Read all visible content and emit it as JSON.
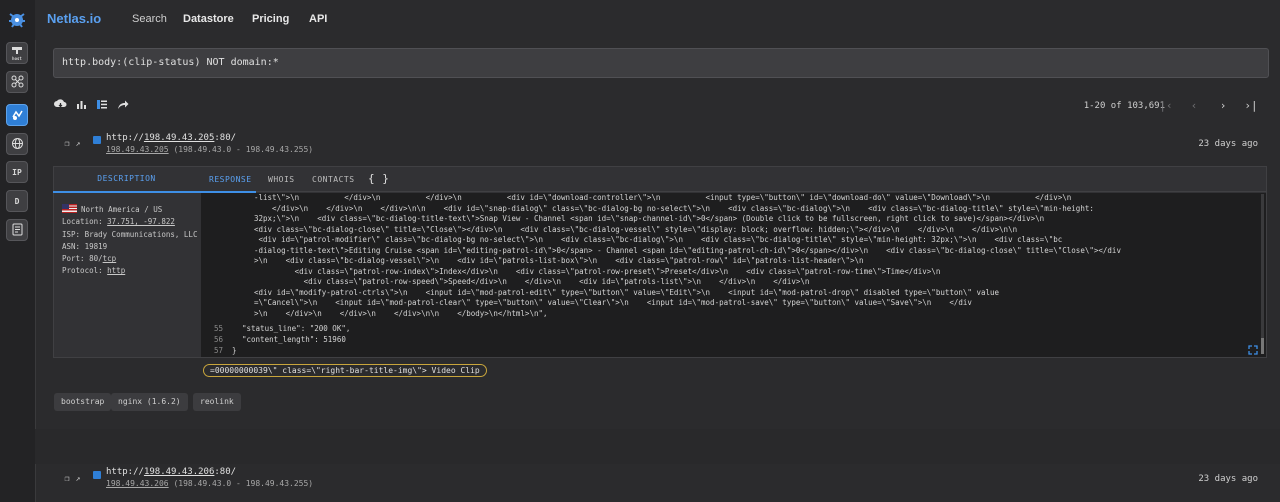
{
  "nav": {
    "brand": "Netlas.io",
    "links": [
      "Search",
      "Datastore",
      "Pricing",
      "API"
    ]
  },
  "rail": [
    {
      "icon": "host-icon",
      "label": "host",
      "active": false
    },
    {
      "icon": "network-icon",
      "label": "",
      "active": false
    },
    {
      "icon": "response-icon",
      "label": "",
      "active": true
    },
    {
      "icon": "globe-icon",
      "label": "",
      "active": false
    },
    {
      "icon": "ip-whois-icon",
      "label": "IP",
      "active": false
    },
    {
      "icon": "domain-whois-icon",
      "label": "D",
      "active": false
    },
    {
      "icon": "certificate-icon",
      "label": "",
      "active": false
    }
  ],
  "search": {
    "query": "http.body:(clip-status) NOT domain:*"
  },
  "pagination": {
    "range": "1-20 of 103,691"
  },
  "results": [
    {
      "url_prefix": "http://",
      "ip": "198.49.43.205",
      "port_suffix": ":80/",
      "range_ip": "198.49.43.205",
      "range_rest": " (198.49.43.0 - 198.49.43.255)",
      "ago": "23 days ago"
    },
    {
      "url_prefix": "http://",
      "ip": "198.49.43.206",
      "port_suffix": ":80/",
      "range_ip": "198.49.43.206",
      "range_rest": " (198.49.43.0 - 198.49.43.255)",
      "ago": "23 days ago"
    }
  ],
  "tabs": {
    "description": "DESCRIPTION",
    "response": "RESPONSE",
    "whois": "WHOIS",
    "contacts": "CONTACTS",
    "json": "{ }"
  },
  "info": {
    "region": "North America / US",
    "location_label": "Location: ",
    "location": "37.751, -97.822",
    "isp": "ISP: Brady Communications, LLC",
    "asn": "ASN: 19819",
    "port_label": "Port: 80/",
    "port_proto": "tcp",
    "protocol_label": "Protocol: ",
    "protocol": "http"
  },
  "code": {
    "lines": [
      "-list\\\">\\n          </div>\\n          </div>\\n          <div id=\\\"download-controller\\\">\\n          <input type=\\\"button\\\" id=\\\"download-do\\\" value=\\\"Download\\\">\\n          </div>\\n",
      "    </div>\\n    </div>\\n    </div>\\n\\n    <div id=\\\"snap-dialog\\\" class=\\\"bc-dialog-bg no-select\\\">\\n    <div class=\\\"bc-dialog\\\">\\n    <div class=\\\"bc-dialog-title\\\" style=\\\"min-height:",
      "32px;\\\">\\n    <div class=\\\"bc-dialog-title-text\\\">Snap View - Channel <span id=\\\"snap-channel-id\\\">0</span> (Double click to be fullscreen, right click to save)</span></div>\\n",
      "<div class=\\\"bc-dialog-close\\\" title=\\\"Close\\\"></div>\\n    <div class=\\\"bc-dialog-vessel\\\" style=\\\"display: block; overflow: hidden;\\\"></div>\\n    </div>\\n    </div>\\n\\n",
      " <div id=\\\"patrol-modifier\\\" class=\\\"bc-dialog-bg no-select\\\">\\n    <div class=\\\"bc-dialog\\\">\\n    <div class=\\\"bc-dialog-title\\\" style=\\\"min-height: 32px;\\\">\\n    <div class=\\\"bc",
      "-dialog-title-text\\\">Editing Cruise <span id=\\\"editing-patrol-id\\\">0</span> - Channel <span id=\\\"editing-patrol-ch-id\\\">0</span></div>\\n    <div class=\\\"bc-dialog-close\\\" title=\\\"Close\\\"></div",
      ">\\n    <div class=\\\"bc-dialog-vessel\\\">\\n    <div id=\\\"patrols-list-box\\\">\\n    <div class=\\\"patrol-row\\\" id=\\\"patrols-list-header\\\">\\n",
      "         <div class=\\\"patrol-row-index\\\">Index</div>\\n    <div class=\\\"patrol-row-preset\\\">Preset</div>\\n    <div class=\\\"patrol-row-time\\\">Time</div>\\n",
      "           <div class=\\\"patrol-row-speed\\\">Speed</div>\\n    </div>\\n    <div id=\\\"patrols-list\\\">\\n    </div>\\n    </div>\\n",
      "<div id=\\\"modify-patrol-ctrls\\\">\\n    <input id=\\\"mod-patrol-edit\\\" type=\\\"button\\\" value=\\\"Edit\\\">\\n    <input id=\\\"mod-patrol-drop\\\" disabled type=\\\"button\\\" value",
      "=\\\"Cancel\\\">\\n    <input id=\\\"mod-patrol-clear\\\" type=\\\"button\\\" value=\\\"Clear\\\">\\n    <input id=\\\"mod-patrol-save\\\" type=\\\"button\\\" value=\\\"Save\\\">\\n    </div",
      ">\\n    </div>\\n    </div>\\n    </div>\\n\\n    </body>\\n</html>\\n\","
    ],
    "json_lines": [
      {
        "n": "55",
        "text": "\"status_line\": \"200 OK\","
      },
      {
        "n": "56",
        "text": "\"content_length\": 51960"
      },
      {
        "n": "57",
        "text": "}"
      }
    ]
  },
  "highlight": "=00000000039\\\" class=\\\"right-bar-title-img\\\"> Video Clip",
  "tags": [
    "bootstrap",
    "nginx (1.6.2)",
    "reolink"
  ]
}
